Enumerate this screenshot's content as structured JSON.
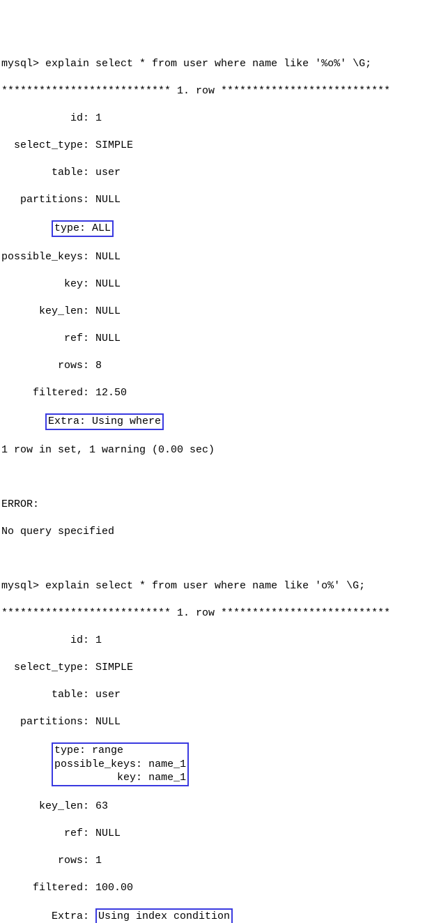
{
  "block1": {
    "prompt": "mysql> ",
    "command": "explain select * from user where name like '%o%' \\G;",
    "row_header": "*************************** 1. row ***************************",
    "fields": {
      "id": {
        "label": "id",
        "value": "1"
      },
      "select_type": {
        "label": "select_type",
        "value": "SIMPLE"
      },
      "table": {
        "label": "table",
        "value": "user"
      },
      "partitions": {
        "label": "partitions",
        "value": "NULL"
      },
      "type": {
        "label": "type",
        "value": "ALL"
      },
      "possible_keys": {
        "label": "possible_keys",
        "value": "NULL"
      },
      "key": {
        "label": "key",
        "value": "NULL"
      },
      "key_len": {
        "label": "key_len",
        "value": "NULL"
      },
      "ref": {
        "label": "ref",
        "value": "NULL"
      },
      "rows": {
        "label": "rows",
        "value": "8"
      },
      "filtered": {
        "label": "filtered",
        "value": "12.50"
      },
      "extra": {
        "label": "Extra",
        "value": "Using where"
      }
    },
    "footer": "1 row in set, 1 warning (0.00 sec)"
  },
  "error": {
    "line1": "ERROR:",
    "line2": "No query specified"
  },
  "block2": {
    "prompt": "mysql> ",
    "command": "explain select * from user where name like 'o%' \\G;",
    "row_header": "*************************** 1. row ***************************",
    "fields": {
      "id": {
        "label": "id",
        "value": "1"
      },
      "select_type": {
        "label": "select_type",
        "value": "SIMPLE"
      },
      "table": {
        "label": "table",
        "value": "user"
      },
      "partitions": {
        "label": "partitions",
        "value": "NULL"
      },
      "type": {
        "label": "type",
        "value": "range"
      },
      "possible_keys": {
        "label": "possible_keys",
        "value": "name_1"
      },
      "key": {
        "label": "key",
        "value": "name_1"
      },
      "key_len": {
        "label": "key_len",
        "value": "63"
      },
      "ref": {
        "label": "ref",
        "value": "NULL"
      },
      "rows": {
        "label": "rows",
        "value": "1"
      },
      "filtered": {
        "label": "filtered",
        "value": "100.00"
      },
      "extra": {
        "label": "Extra",
        "value": "Using index condition"
      }
    }
  }
}
